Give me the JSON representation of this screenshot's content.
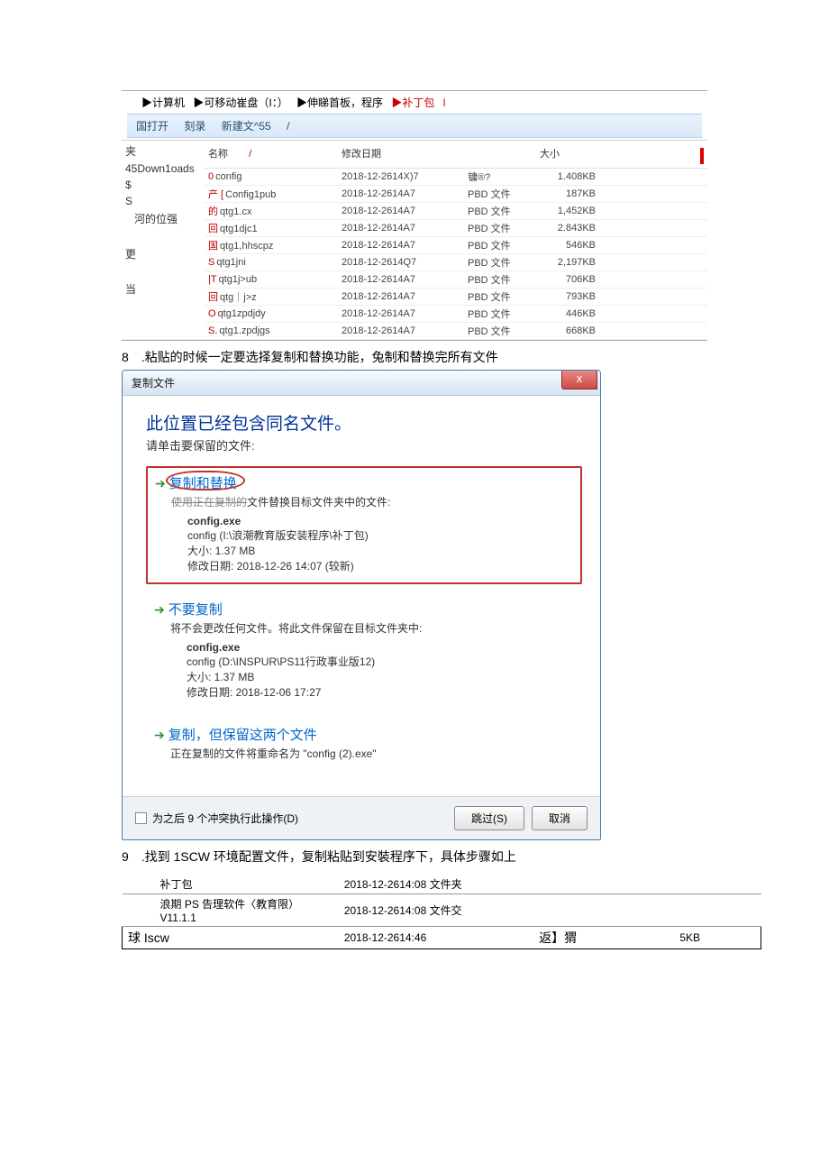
{
  "top_explorer": {
    "crumbs": [
      "▶计算机",
      "▶可移动崔盘（I：）",
      "▶伸睇首板，程序",
      "▶补丁包"
    ],
    "toolbar": {
      "open": "国打开",
      "burn": "刻录",
      "new": "新建文^55",
      "sep": "/",
      "folder_label": "夹"
    },
    "headers": {
      "name": "名称",
      "date": "修改日期",
      "size": "大小"
    },
    "sidebar": [
      "45Down1oads",
      "$",
      "S",
      "河的位强",
      "",
      "更",
      "",
      "当"
    ],
    "rows": [
      {
        "pre": "0",
        "name": "config",
        "date": "2018-12-2614X)7",
        "type": "镛®?",
        "size": "1.408KB"
      },
      {
        "pre": "产 [",
        "name": "Config1pub",
        "date": "2018-12-2614A7",
        "type": "PBD 文件",
        "size": "187KB"
      },
      {
        "pre": "的",
        "name": "qtg1.cx",
        "date": "2018-12-2614A7",
        "type": "PBD 文件",
        "size": "1,452KB"
      },
      {
        "pre": "回",
        "name": "qtg1djc1",
        "date": "2018-12-2614A7",
        "type": "PBD 文件",
        "size": "2.843KB"
      },
      {
        "pre": "国",
        "name": "qtg1,hhscpz",
        "date": "2018-12-2614A7",
        "type": "PBD 文件",
        "size": "546KB"
      },
      {
        "pre": "S",
        "name": "qtg1jni",
        "date": "2018-12-2614Q7",
        "type": "PBD 文件",
        "size": "2,197KB"
      },
      {
        "pre": "|T",
        "name": "qtg1j>ub",
        "date": "2018-12-2614A7",
        "type": "PBD 文件",
        "size": "706KB"
      },
      {
        "pre": "回",
        "name": "qtg｜j>z",
        "date": "2018-12-2614A7",
        "type": "PBD 文件",
        "size": "793KB"
      },
      {
        "pre": "O",
        "name": "qtg1zpdjdy",
        "date": "2018-12-2614A7",
        "type": "PBD 文件",
        "size": "446KB"
      },
      {
        "pre": "S.",
        "name": "qtg1.zpdjgs",
        "date": "2018-12-2614A7",
        "type": "PBD 文件",
        "size": "668KB"
      }
    ]
  },
  "step8": {
    "label": "8　.粘贴的时候一定要选择复制和替换功能，兔制和替换完所有文件",
    "dlg_title": "复制文件",
    "close": "x",
    "heading": "此位置已经包含同名文件。",
    "sub": "请单击要保留的文件:",
    "opt1": {
      "title": "复制和替换",
      "desc_pre": "使用正在复制的",
      "desc_post": "文件替换目标文件夹中的文件:",
      "fname": "config.exe",
      "floc": "config (I:\\浪潮教育版安装程序\\补丁包)",
      "fsize": "大小: 1.37 MB",
      "fdate": "修改日期: 2018-12-26 14:07 (较新)"
    },
    "opt2": {
      "title": "不要复制",
      "desc": "将不会更改任何文件。将此文件保留在目标文件夹中:",
      "fname": "config.exe",
      "floc": "config (D:\\INSPUR\\PS11行政事业版12)",
      "fsize": "大小: 1.37 MB",
      "fdate": "修改日期: 2018-12-06 17:27"
    },
    "opt3": {
      "title": "复制，但保留这两个文件",
      "desc": "正在复制的文件将重命名为 \"config (2).exe\""
    },
    "footer_check": "为之后 9 个冲突执行此操作(D)",
    "skip": "跳过(S)",
    "cancel": "取消"
  },
  "step9": {
    "label": "9　.找到 1SCW 环境配置文件，复制粘贴到安裝程序下，具体步骤如上",
    "rows": [
      {
        "c1": "补丁包",
        "c2": "2018-12-2614:08 文件夹",
        "c3": "",
        "c4": ""
      },
      {
        "c1": "浪期 PS 告理软件〈教育限）V11.1.1",
        "c2": "2018-12-2614:08 文件交",
        "c3": "",
        "c4": ""
      },
      {
        "c1": "球 Iscw",
        "c2": "2018-12-2614:46",
        "c3": "返】猬",
        "c4": "5KB"
      }
    ]
  }
}
